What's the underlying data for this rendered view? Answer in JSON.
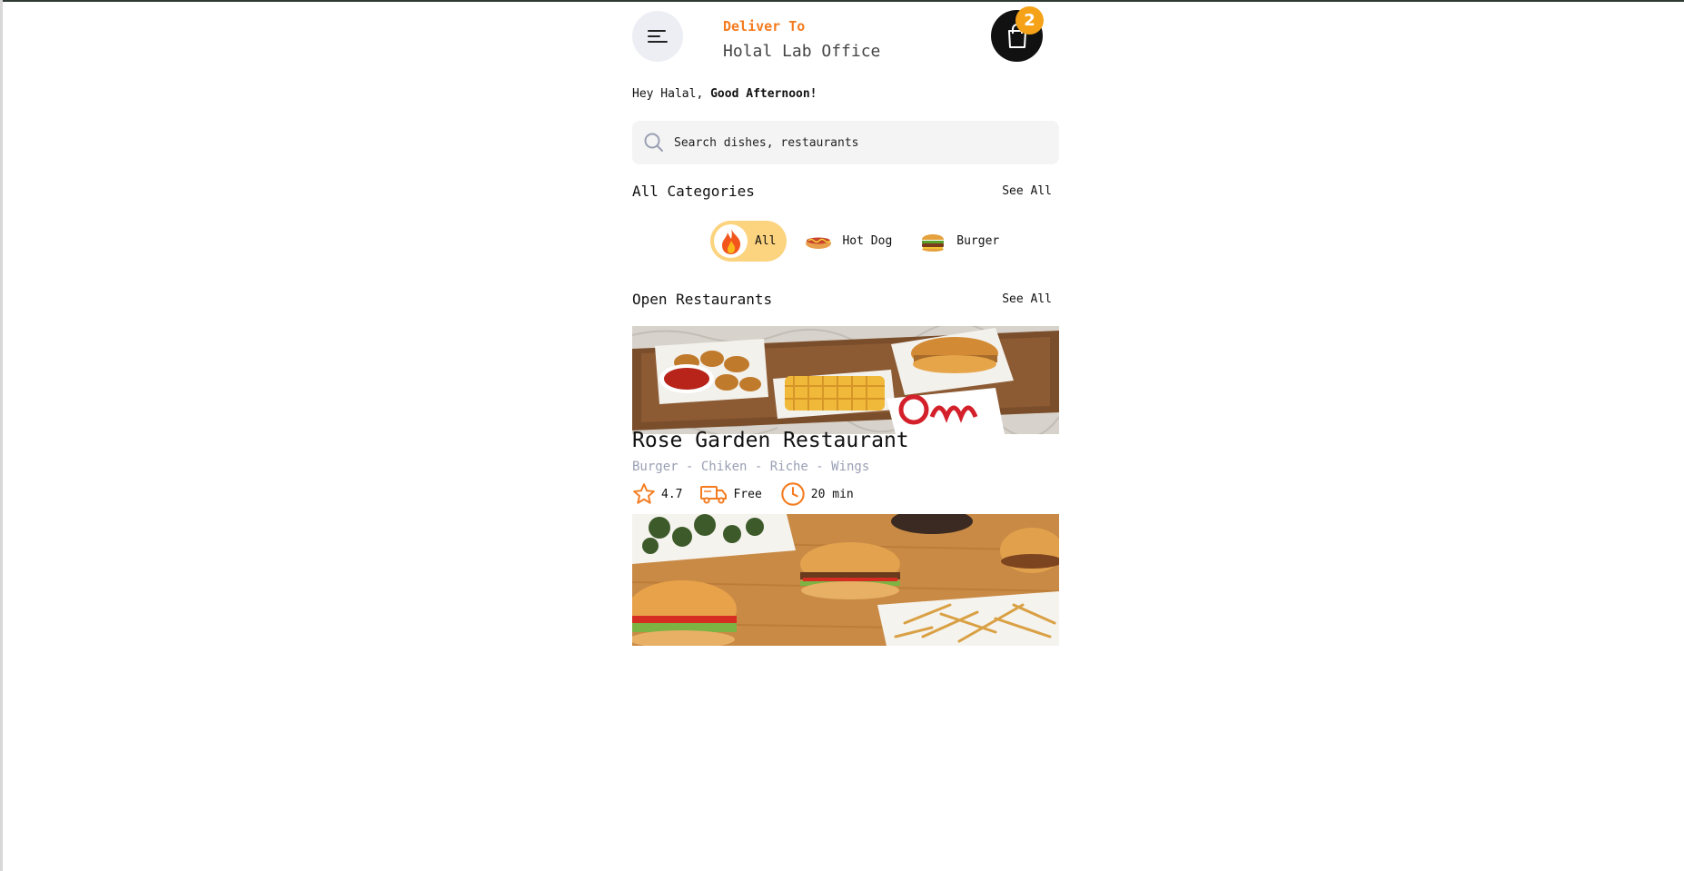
{
  "header": {
    "menu_icon": "menu-icon",
    "deliver_label": "Deliver To",
    "deliver_place": "Holal Lab Office",
    "cart_count": "2"
  },
  "greeting": {
    "prefix": "Hey Halal,",
    "emphasis": "Good Afternoon!"
  },
  "search": {
    "placeholder": "Search dishes, restaurants"
  },
  "categories": {
    "title": "All Categories",
    "see_all": "See All",
    "items": [
      {
        "label": "All",
        "icon": "fire-icon",
        "active": true
      },
      {
        "label": "Hot Dog",
        "icon": "hotdog-icon",
        "active": false
      },
      {
        "label": "Burger",
        "icon": "burger-icon",
        "active": false
      }
    ]
  },
  "restaurants": {
    "title": "Open Restaurants",
    "see_all": "See All",
    "items": [
      {
        "name": "Rose Garden Restaurant",
        "tags": "Burger - Chiken - Riche - Wings",
        "rating": "4.7",
        "delivery": "Free",
        "time": "20 min"
      }
    ]
  },
  "colors": {
    "accent": "#f47c20",
    "badge": "#f5a218",
    "active_category": "#fcd37e"
  }
}
